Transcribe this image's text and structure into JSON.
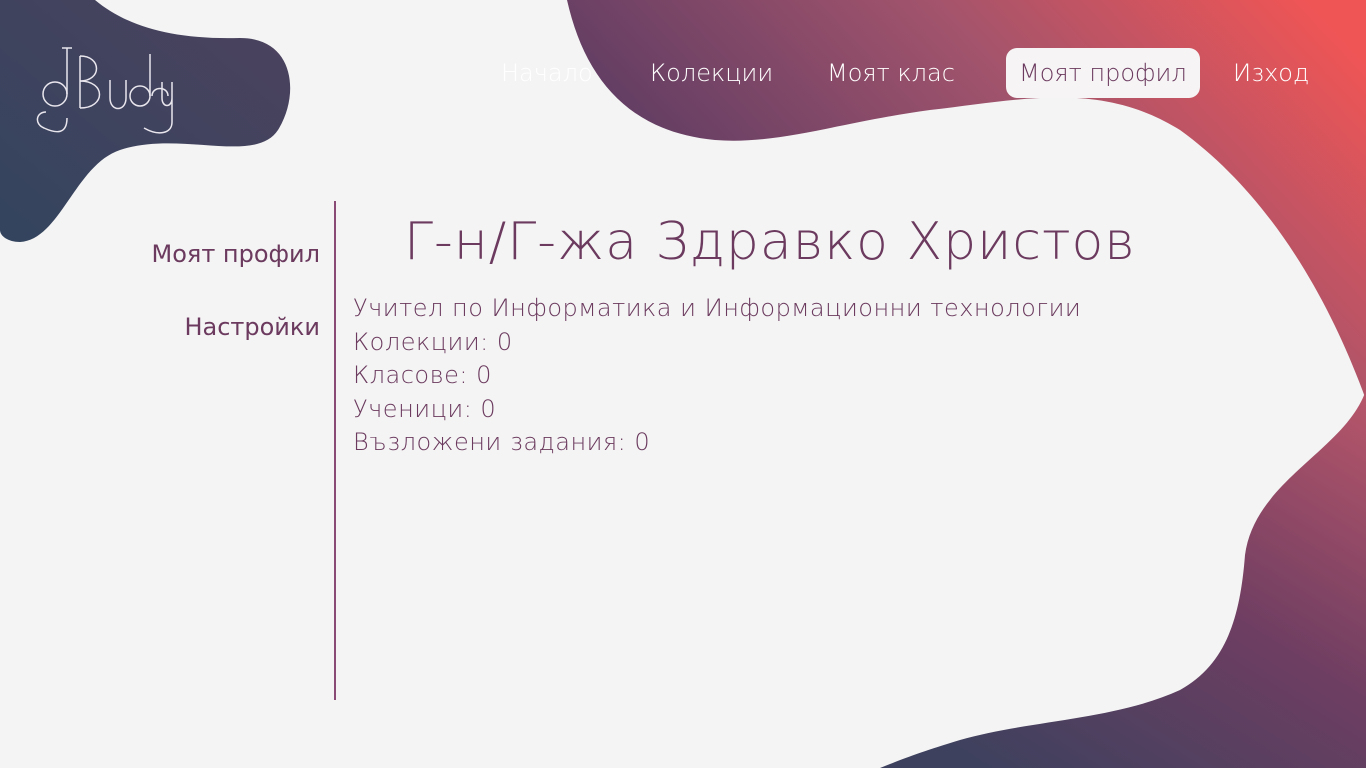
{
  "brand": {
    "logo_text": "dBuddy",
    "colors": {
      "dark_blue": "#33445e",
      "purple": "#6b3a5e",
      "coral": "#f05555",
      "background": "#f4f4f4"
    }
  },
  "nav": {
    "items": [
      {
        "label": "Начало"
      },
      {
        "label": "Колекции"
      },
      {
        "label": "Моят клас"
      },
      {
        "label": "Моят профил",
        "active": true
      },
      {
        "label": "Изход"
      }
    ]
  },
  "sidebar": {
    "items": [
      {
        "label": "Моят профил",
        "active": true
      },
      {
        "label": "Настройки"
      }
    ]
  },
  "profile": {
    "title": "Г-н/Г-жа Здравко Христов",
    "role": "Учител по Информатика и Информационни технологии",
    "collections": "Колекции: 0",
    "classes": "Класове: 0",
    "students": "Ученици: 0",
    "assignments": "Възложени задания: 0"
  }
}
